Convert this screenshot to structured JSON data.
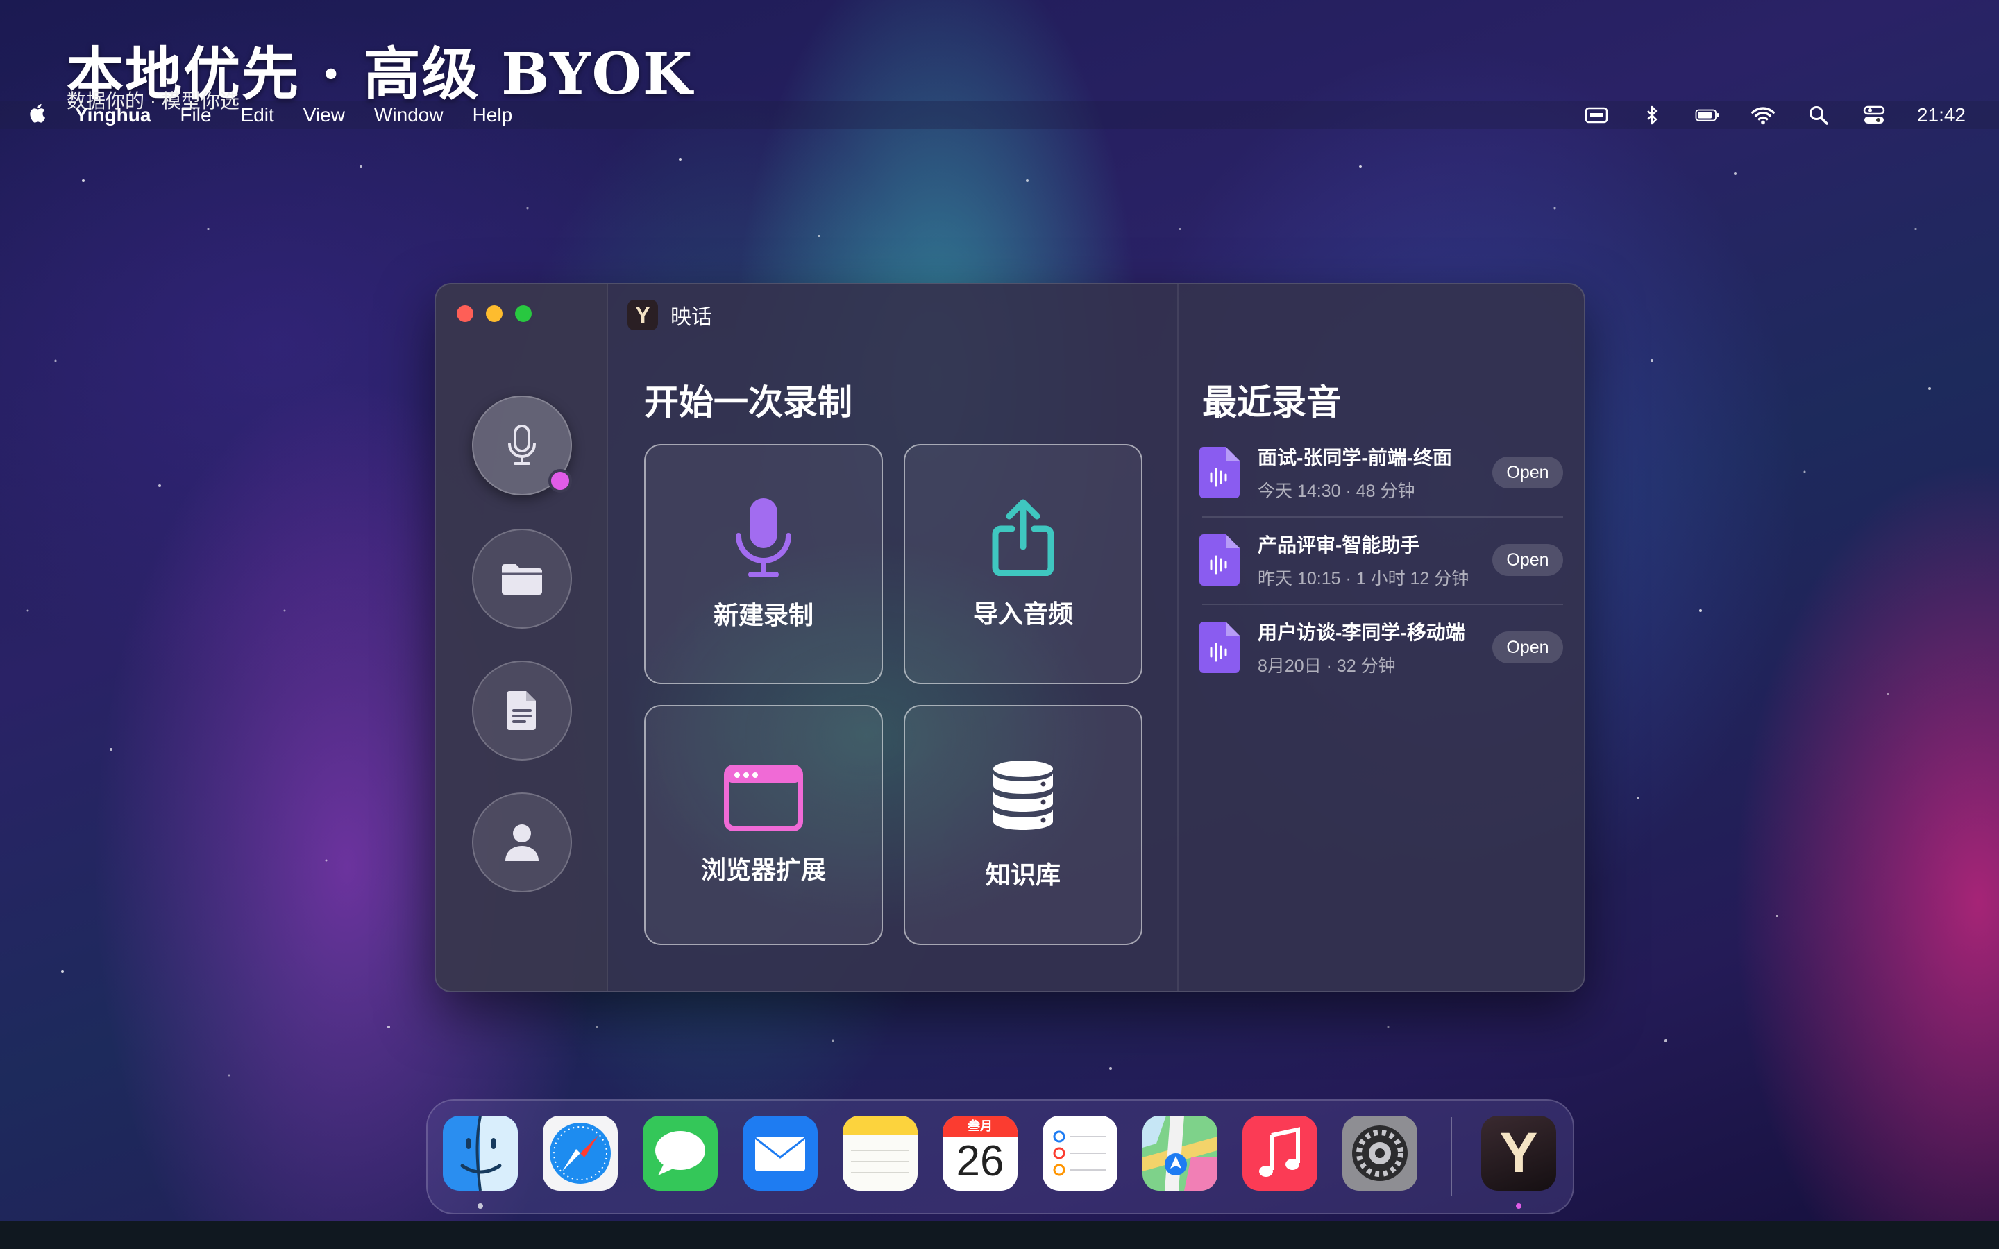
{
  "headline": {
    "title": "本地优先 · 高级 BYOK",
    "subtitle": "数据你的 · 模型你选"
  },
  "menubar": {
    "app_name": "Yinghua",
    "items": [
      "File",
      "Edit",
      "View",
      "Window",
      "Help"
    ],
    "clock": "21:42"
  },
  "window": {
    "title": "映话",
    "app_letter": "Y",
    "start_section": {
      "title": "开始一次录制",
      "tiles": [
        {
          "label": "新建录制",
          "icon": "microphone-icon",
          "color": "#a26cf0"
        },
        {
          "label": "导入音频",
          "icon": "share-upload-icon",
          "color": "#3fc7c0"
        },
        {
          "label": "浏览器扩展",
          "icon": "browser-window-icon",
          "color": "#f06ad6"
        },
        {
          "label": "知识库",
          "icon": "database-icon",
          "color": "#ffffff"
        }
      ]
    },
    "recent_section": {
      "title": "最近录音",
      "items": [
        {
          "title": "面试-张同学-前端-终面",
          "meta": "今天 14:30 · 48 分钟",
          "action": "Open"
        },
        {
          "title": "产品评审-智能助手",
          "meta": "昨天 10:15 · 1 小时 12 分钟",
          "action": "Open"
        },
        {
          "title": "用户访谈-李同学-移动端",
          "meta": "8月20日 · 32 分钟",
          "action": "Open"
        }
      ]
    },
    "sidebar": [
      "microphone-icon",
      "folder-icon",
      "document-icon",
      "person-icon"
    ]
  },
  "dock": {
    "calendar_month": "叁月",
    "calendar_day": "26",
    "app_letter": "Y",
    "apps": [
      "Finder",
      "Safari",
      "Messages",
      "Mail",
      "Notes",
      "Calendar",
      "Reminders",
      "Maps",
      "Music",
      "System Settings",
      "Yinghua"
    ]
  }
}
